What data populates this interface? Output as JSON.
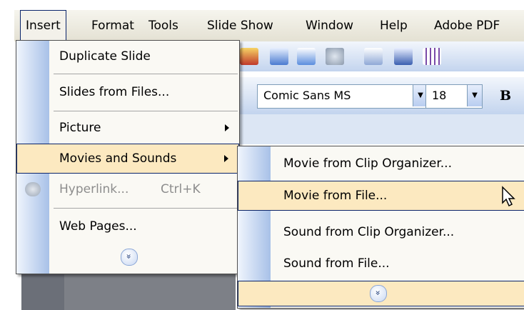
{
  "menubar": {
    "items": [
      "Insert",
      "Format",
      "Tools",
      "Slide Show",
      "Window",
      "Help",
      "Adobe PDF"
    ]
  },
  "toolbar": {
    "font_name": "Comic Sans MS",
    "font_size": "18",
    "bold_label": "B"
  },
  "insert_menu": {
    "items": [
      {
        "label": "Duplicate Slide"
      },
      {
        "label": "Slides from Files..."
      },
      {
        "label": "Picture"
      },
      {
        "label": "Movies and Sounds"
      },
      {
        "label": "Hyperlink...",
        "shortcut": "Ctrl+K"
      },
      {
        "label": "Web Pages..."
      }
    ],
    "expand_glyph": "»"
  },
  "movies_submenu": {
    "items": [
      {
        "label": "Movie from Clip Organizer..."
      },
      {
        "label": "Movie from File..."
      },
      {
        "label": "Sound from Clip Organizer..."
      },
      {
        "label": "Sound from File..."
      }
    ],
    "expand_glyph": "»"
  },
  "colors": {
    "highlight": "#fce9c0",
    "highlight_border": "#0a246a",
    "menu_strip": "#a8c1e8"
  }
}
